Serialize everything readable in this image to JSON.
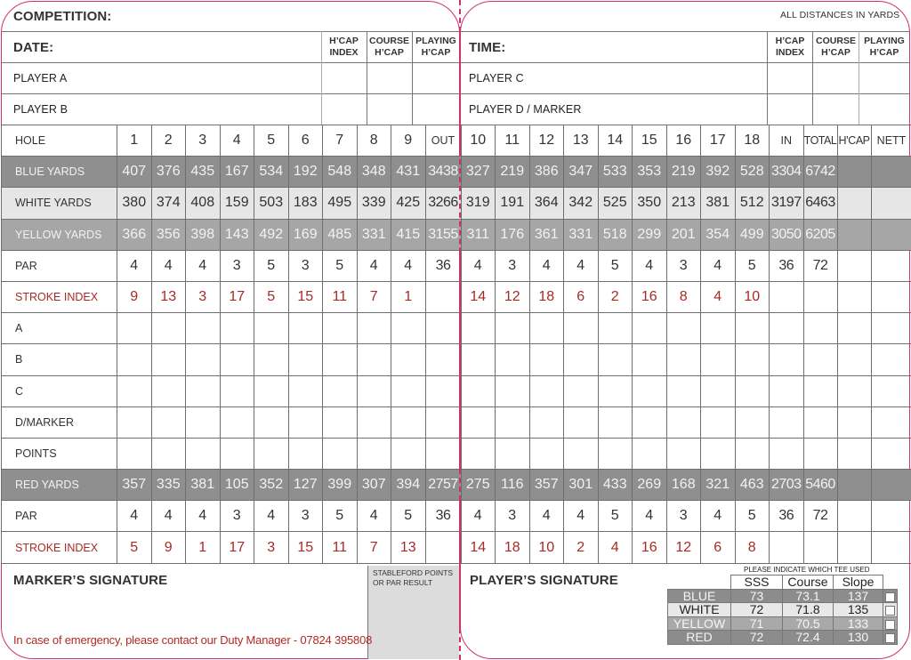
{
  "header": {
    "competition_label": "COMPETITION:",
    "distances_note": "ALL DISTANCES IN YARDS",
    "date_label": "DATE:",
    "time_label": "TIME:",
    "hcap_index_label": [
      "H’CAP",
      "INDEX"
    ],
    "course_hcap_label": [
      "COURSE",
      "H’CAP"
    ],
    "playing_hcap_label": [
      "PLAYING",
      "H’CAP"
    ]
  },
  "players": {
    "left": [
      "PLAYER A",
      "PLAYER B"
    ],
    "right": [
      "PLAYER C",
      "PLAYER D / MARKER"
    ]
  },
  "scorecard": {
    "hole_label": "HOLE",
    "holes_front": [
      "1",
      "2",
      "3",
      "4",
      "5",
      "6",
      "7",
      "8",
      "9"
    ],
    "out_label": "OUT",
    "holes_back": [
      "10",
      "11",
      "12",
      "13",
      "14",
      "15",
      "16",
      "17",
      "18"
    ],
    "in_label": "IN",
    "total_label": "TOTAL",
    "hcap_label": "H’CAP",
    "nett_label": "NETT",
    "rows": {
      "blue": {
        "label": "BLUE YARDS",
        "front": [
          "407",
          "376",
          "435",
          "167",
          "534",
          "192",
          "548",
          "348",
          "431"
        ],
        "out": "3438",
        "back": [
          "327",
          "219",
          "386",
          "347",
          "533",
          "353",
          "219",
          "392",
          "528"
        ],
        "in": "3304",
        "total": "6742"
      },
      "white": {
        "label": "WHITE YARDS",
        "front": [
          "380",
          "374",
          "408",
          "159",
          "503",
          "183",
          "495",
          "339",
          "425"
        ],
        "out": "3266",
        "back": [
          "319",
          "191",
          "364",
          "342",
          "525",
          "350",
          "213",
          "381",
          "512"
        ],
        "in": "3197",
        "total": "6463"
      },
      "yellow": {
        "label": "YELLOW YARDS",
        "front": [
          "366",
          "356",
          "398",
          "143",
          "492",
          "169",
          "485",
          "331",
          "415"
        ],
        "out": "3155",
        "back": [
          "311",
          "176",
          "361",
          "331",
          "518",
          "299",
          "201",
          "354",
          "499"
        ],
        "in": "3050",
        "total": "6205"
      },
      "par_men": {
        "label": "PAR",
        "front": [
          "4",
          "4",
          "4",
          "3",
          "5",
          "3",
          "5",
          "4",
          "4"
        ],
        "out": "36",
        "back": [
          "4",
          "3",
          "4",
          "4",
          "5",
          "4",
          "3",
          "4",
          "5"
        ],
        "in": "36",
        "total": "72"
      },
      "si_men": {
        "label": "STROKE INDEX",
        "front": [
          "9",
          "13",
          "3",
          "17",
          "5",
          "15",
          "11",
          "7",
          "1"
        ],
        "back": [
          "14",
          "12",
          "18",
          "6",
          "2",
          "16",
          "8",
          "4",
          "10"
        ]
      },
      "score_rows": [
        "A",
        "B",
        "C",
        "D/MARKER",
        "POINTS"
      ],
      "red": {
        "label": "RED YARDS",
        "front": [
          "357",
          "335",
          "381",
          "105",
          "352",
          "127",
          "399",
          "307",
          "394"
        ],
        "out": "2757",
        "back": [
          "275",
          "116",
          "357",
          "301",
          "433",
          "269",
          "168",
          "321",
          "463"
        ],
        "in": "2703",
        "total": "5460"
      },
      "par_ladies": {
        "label": "PAR",
        "front": [
          "4",
          "4",
          "4",
          "3",
          "4",
          "3",
          "5",
          "4",
          "5"
        ],
        "out": "36",
        "back": [
          "4",
          "3",
          "4",
          "4",
          "5",
          "4",
          "3",
          "4",
          "5"
        ],
        "in": "36",
        "total": "72"
      },
      "si_ladies": {
        "label": "STROKE INDEX",
        "front": [
          "5",
          "9",
          "1",
          "17",
          "3",
          "15",
          "11",
          "7",
          "13"
        ],
        "back": [
          "14",
          "18",
          "10",
          "2",
          "4",
          "16",
          "12",
          "6",
          "8"
        ]
      }
    }
  },
  "footer": {
    "marker_signature": "MARKER’S SIGNATURE",
    "player_signature": "PLAYER’S SIGNATURE",
    "stableford_note": [
      "STABLEFORD POINTS",
      "OR PAR RESULT"
    ],
    "emergency": "In case of emergency, please contact our Duty Manager - 07824 395808",
    "tee_caption": "PLEASE INDICATE WHICH TEE USED",
    "tee_headers": [
      "SSS",
      "Course",
      "Slope"
    ],
    "tees": [
      {
        "name": "BLUE",
        "sss": "73",
        "course": "73.1",
        "slope": "137"
      },
      {
        "name": "WHITE",
        "sss": "72",
        "course": "71.8",
        "slope": "135"
      },
      {
        "name": "YELLOW",
        "sss": "71",
        "course": "70.5",
        "slope": "133"
      },
      {
        "name": "RED",
        "sss": "72",
        "course": "72.4",
        "slope": "130"
      }
    ]
  },
  "colors": {
    "border_accent": "#d0306f",
    "stroke_index_text": "#a72b25",
    "dark_row": "#8f8f8f",
    "light_row": "#e6e6e6",
    "yellow_row": "#a6a6a6"
  }
}
